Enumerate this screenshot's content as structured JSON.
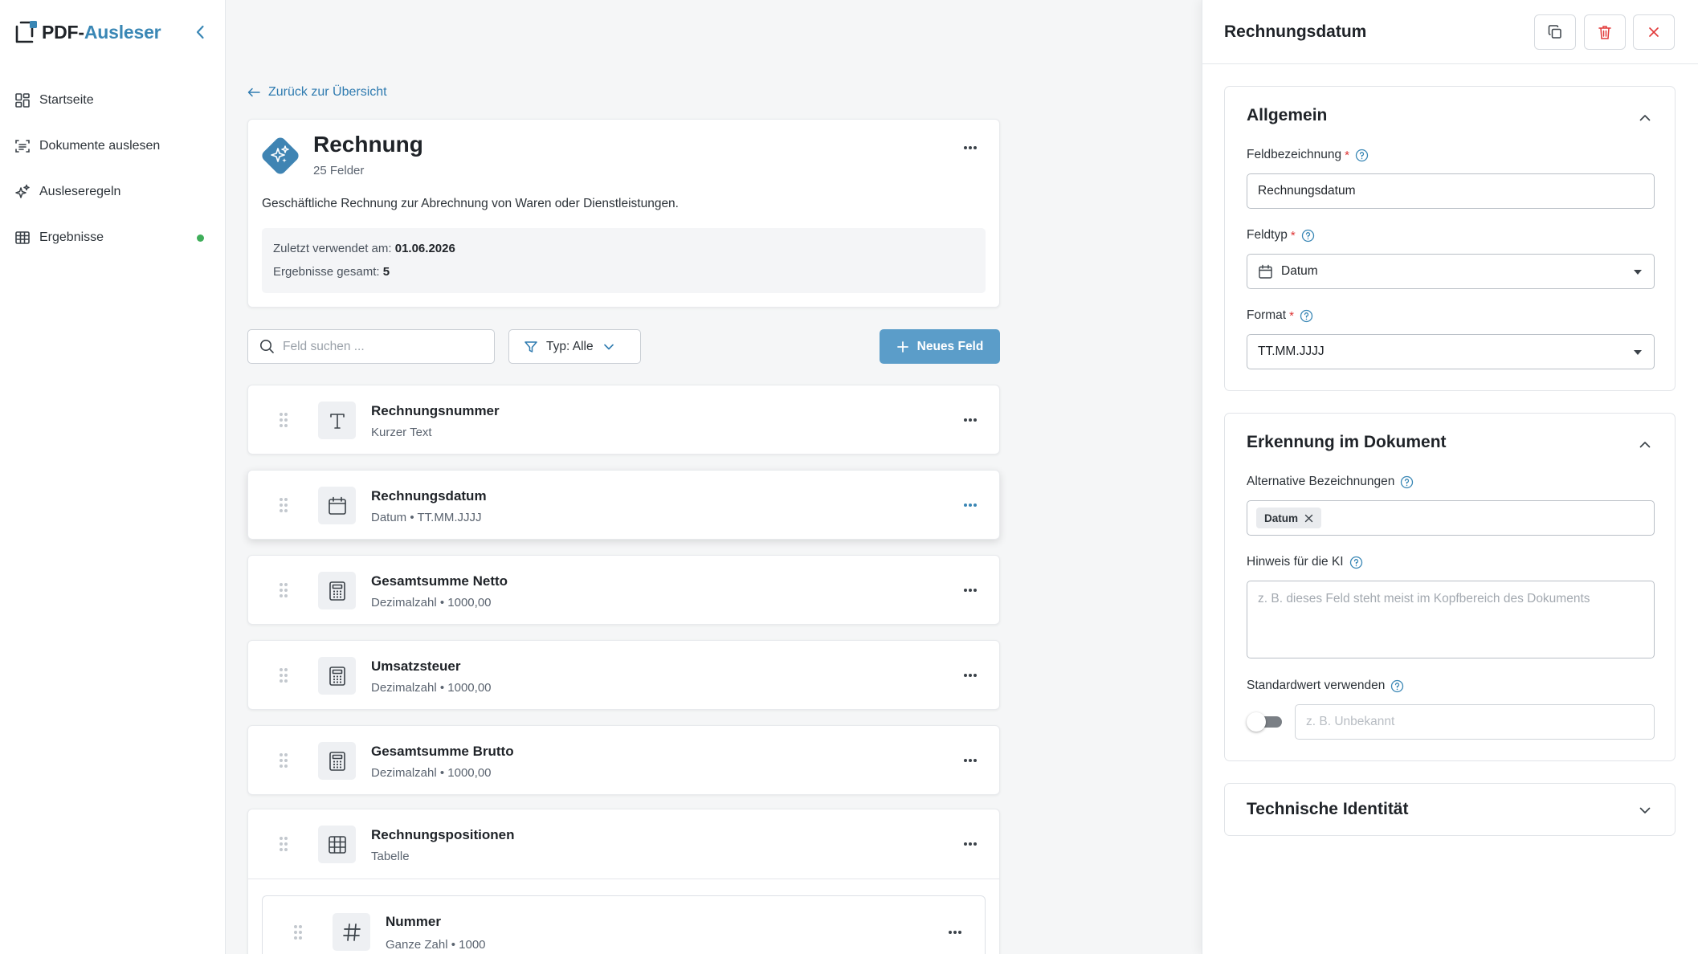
{
  "app": {
    "logo_part1": "PDF-",
    "logo_part2": "Ausleser"
  },
  "sidebar": {
    "items": [
      {
        "label": "Startseite",
        "icon": "dashboard-icon"
      },
      {
        "label": "Dokumente auslesen",
        "icon": "document-scan-icon"
      },
      {
        "label": "Ausleseregeln",
        "icon": "sparkles-icon"
      },
      {
        "label": "Ergebnisse",
        "icon": "table-icon",
        "status_dot": "#3fae5a"
      }
    ]
  },
  "main": {
    "back_link": "Zurück zur Übersicht",
    "document_type": {
      "title": "Rechnung",
      "field_count": "25 Felder",
      "description": "Geschäftliche Rechnung zur Abrechnung von Waren oder Dienstleistungen.",
      "last_used_label": "Zuletzt verwendet am:",
      "last_used_value": "01.06.2026",
      "results_label": "Ergebnisse gesamt:",
      "results_value": "5"
    },
    "search_placeholder": "Feld suchen ...",
    "filter_label": "Typ: Alle",
    "new_field_button": "Neues Feld",
    "fields": [
      {
        "name": "Rechnungsnummer",
        "meta": "Kurzer Text",
        "icon": "text-icon"
      },
      {
        "name": "Rechnungsdatum",
        "meta": "Datum • TT.MM.JJJJ",
        "icon": "calendar-icon",
        "active": true
      },
      {
        "name": "Gesamtsumme Netto",
        "meta": "Dezimalzahl • 1000,00",
        "icon": "calculator-icon"
      },
      {
        "name": "Umsatzsteuer",
        "meta": "Dezimalzahl • 1000,00",
        "icon": "calculator-icon"
      },
      {
        "name": "Gesamtsumme Brutto",
        "meta": "Dezimalzahl • 1000,00",
        "icon": "calculator-icon"
      },
      {
        "name": "Rechnungspositionen",
        "meta": "Tabelle",
        "icon": "table-icon"
      }
    ],
    "sub_fields": [
      {
        "name": "Nummer",
        "meta": "Ganze Zahl • 1000",
        "icon": "hash-icon"
      }
    ]
  },
  "panel": {
    "title": "Rechnungsdatum",
    "general": {
      "title": "Allgemein",
      "field_label_label": "Feldbezeichnung",
      "field_label_value": "Rechnungsdatum",
      "field_type_label": "Feldtyp",
      "field_type_value": "Datum",
      "format_label": "Format",
      "format_value": "TT.MM.JJJJ"
    },
    "recognition": {
      "title": "Erkennung im Dokument",
      "alt_names_label": "Alternative Bezeichnungen",
      "alt_names": [
        "Datum"
      ],
      "ai_hint_label": "Hinweis für die KI",
      "ai_hint_placeholder": "z. B. dieses Feld steht meist im Kopfbereich des Dokuments",
      "default_label": "Standardwert verwenden",
      "default_enabled": false,
      "default_placeholder": "z. B. Unbekannt"
    },
    "technical": {
      "title": "Technische Identität"
    }
  },
  "colors": {
    "accent": "#3a87b5",
    "primary_button": "#5b9dc9",
    "danger": "#e23b3b",
    "required": "#dd3333"
  }
}
